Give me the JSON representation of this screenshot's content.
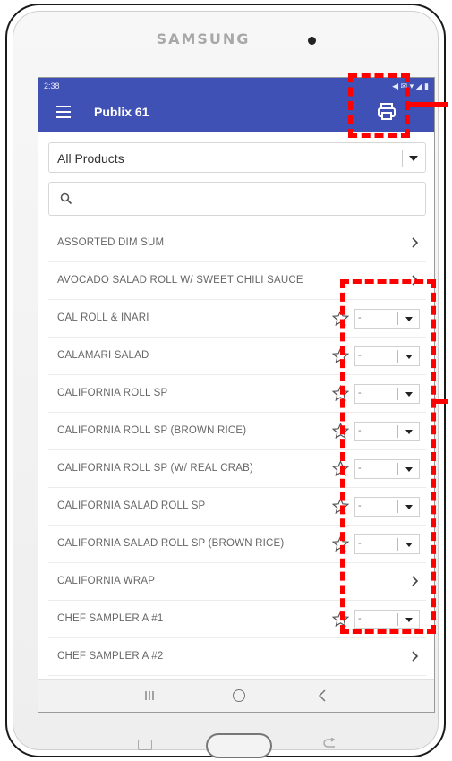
{
  "device": {
    "brand": "SAMSUNG"
  },
  "status_bar": {
    "time": "2:38",
    "icons_text": "◀ ✉ ▾ ◢ ▮"
  },
  "app_bar": {
    "title": "Publix 61",
    "menu_icon": "hamburger-icon",
    "print_icon": "printer-icon"
  },
  "filter": {
    "selected": "All Products"
  },
  "search": {
    "placeholder": ""
  },
  "products": [
    {
      "name": "ASSORTED DIM SUM",
      "has_qty": false,
      "qty": ""
    },
    {
      "name": "AVOCADO SALAD ROLL W/ SWEET CHILI SAUCE",
      "has_qty": false,
      "qty": ""
    },
    {
      "name": "CAL ROLL & INARI",
      "has_qty": true,
      "qty": "-"
    },
    {
      "name": "CALAMARI SALAD",
      "has_qty": true,
      "qty": "-"
    },
    {
      "name": "CALIFORNIA ROLL SP",
      "has_qty": true,
      "qty": "-"
    },
    {
      "name": "CALIFORNIA ROLL SP (BROWN RICE)",
      "has_qty": true,
      "qty": "-"
    },
    {
      "name": "CALIFORNIA ROLL SP (W/ REAL CRAB)",
      "has_qty": true,
      "qty": "-"
    },
    {
      "name": "CALIFORNIA SALAD ROLL SP",
      "has_qty": true,
      "qty": "-"
    },
    {
      "name": "CALIFORNIA SALAD ROLL SP (BROWN RICE)",
      "has_qty": true,
      "qty": "-"
    },
    {
      "name": "CALIFORNIA WRAP",
      "has_qty": false,
      "qty": ""
    },
    {
      "name": "CHEF SAMPLER A #1",
      "has_qty": true,
      "qty": "-"
    },
    {
      "name": "CHEF SAMPLER A #2",
      "has_qty": false,
      "qty": ""
    }
  ],
  "colors": {
    "app_bar": "#3f51b5",
    "callout": "#ff0000"
  }
}
